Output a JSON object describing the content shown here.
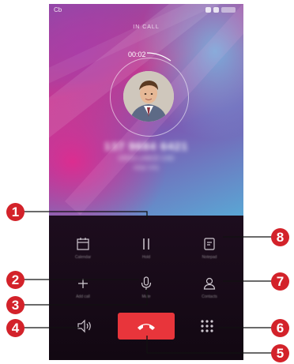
{
  "status_bar": {
    "carrier": "Cb"
  },
  "call": {
    "state_label": "IN CALL",
    "timer": "00:02",
    "number": "137 9684 6421",
    "location": "GRAS LANCE CAD",
    "carrier": "FEW YPS"
  },
  "controls": {
    "calendar_label": "Calendar",
    "hold_label": "Hold",
    "notepad_label": "Notepad",
    "add_call_label": "Add call",
    "mute_label": "Mute",
    "contacts_label": "Contacts"
  },
  "callouts": [
    "1",
    "2",
    "3",
    "4",
    "5",
    "6",
    "7",
    "8"
  ],
  "colors": {
    "end_call": "#e8353b",
    "callout": "#d3222a"
  },
  "icons": {
    "calendar": "calendar-icon",
    "hold": "pause-icon",
    "notepad": "notepad-icon",
    "add_call": "plus-icon",
    "mute": "microphone-icon",
    "contacts": "person-icon",
    "speaker": "speaker-icon",
    "end_call": "phone-hangup-icon",
    "dialpad": "dialpad-icon"
  }
}
